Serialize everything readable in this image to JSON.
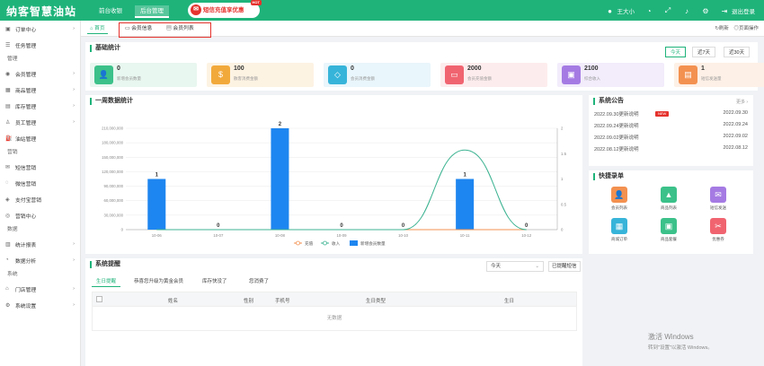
{
  "header": {
    "logo": "纳客智慧油站",
    "tabs": [
      "前台收银",
      "后台管理"
    ],
    "promo": "短信充值享优惠",
    "promo_badge": "HOT",
    "user": "王大小",
    "logout": "退出登录"
  },
  "sidebar": {
    "items": [
      {
        "label": "订单中心",
        "icon": "order-icon",
        "arrow": true
      },
      {
        "label": "任务管理",
        "icon": "task-icon",
        "arrow": false
      },
      {
        "group": "管理"
      },
      {
        "label": "会员管理",
        "icon": "member-icon",
        "arrow": true
      },
      {
        "label": "商品管理",
        "icon": "goods-icon",
        "arrow": true
      },
      {
        "label": "库存管理",
        "icon": "stock-icon",
        "arrow": true
      },
      {
        "label": "员工管理",
        "icon": "staff-icon",
        "arrow": true
      },
      {
        "label": "油站管理",
        "icon": "station-icon",
        "arrow": false
      },
      {
        "group": "营销"
      },
      {
        "label": "短信营销",
        "icon": "sms-icon",
        "arrow": false
      },
      {
        "label": "微信营销",
        "icon": "wechat-icon",
        "arrow": false
      },
      {
        "label": "支付宝营销",
        "icon": "alipay-icon",
        "arrow": false
      },
      {
        "label": "营销中心",
        "icon": "marketing-icon",
        "arrow": false
      },
      {
        "group": "数据"
      },
      {
        "label": "统计报表",
        "icon": "report-icon",
        "arrow": true
      },
      {
        "label": "数据分析",
        "icon": "analysis-icon",
        "arrow": true
      },
      {
        "group": "系统"
      },
      {
        "label": "门店管理",
        "icon": "store-icon",
        "arrow": true
      },
      {
        "label": "系统设置",
        "icon": "settings-icon",
        "arrow": true
      }
    ]
  },
  "tabbar": {
    "home": "首页",
    "member_info": "会员信息",
    "member_list": "会员列表",
    "refresh": "刷新",
    "page_ops": "页面操作"
  },
  "basic": {
    "title": "基础统计",
    "ranges": [
      "今天",
      "近7天",
      "近30天"
    ],
    "cards": [
      {
        "value": "0",
        "label": "新增会员数量",
        "bg": "#e8f7f0",
        "color": "#3cc18a",
        "icon": "person-icon",
        "glyph": "👤"
      },
      {
        "value": "100",
        "label": "散客消费金额",
        "bg": "#fdf3e3",
        "color": "#f2a93b",
        "icon": "coin-icon",
        "glyph": "$"
      },
      {
        "value": "0",
        "label": "会员消费金额",
        "bg": "#e9f6fb",
        "color": "#37b4d9",
        "icon": "diamond-icon",
        "glyph": "◇"
      },
      {
        "value": "2000",
        "label": "会员充值金额",
        "bg": "#fdeced",
        "color": "#f06470",
        "icon": "card-icon",
        "glyph": "▭"
      },
      {
        "value": "2100",
        "label": "综合收入",
        "bg": "#f2ecfb",
        "color": "#a57be3",
        "icon": "wallet-icon",
        "glyph": "▣"
      },
      {
        "value": "1",
        "label": "短信发送量",
        "bg": "#fdf0e6",
        "color": "#f39150",
        "icon": "document-icon",
        "glyph": "▤"
      }
    ]
  },
  "week": {
    "title": "一周数据统计"
  },
  "chart_data": {
    "type": "bar",
    "categories": [
      "10-06",
      "10-07",
      "10-08",
      "10-09",
      "10-10",
      "10-11",
      "10-12"
    ],
    "series": [
      {
        "name": "充值",
        "type": "line",
        "axis": "left",
        "values": [
          0,
          0,
          0,
          0,
          0,
          0,
          0
        ],
        "color": "#f39150"
      },
      {
        "name": "收入",
        "type": "line",
        "axis": "left",
        "values": [
          0,
          0,
          0,
          0,
          0,
          165000000,
          0
        ],
        "color": "#3cb391"
      },
      {
        "name": "新增会员数量",
        "type": "bar",
        "axis": "right",
        "values": [
          1,
          0,
          2,
          0,
          0,
          1,
          0
        ],
        "color": "#1e86f0"
      }
    ],
    "left_ticks": [
      "0",
      "30,000,000",
      "60,000,000",
      "90,000,000",
      "120,000,000",
      "150,000,000",
      "180,000,000",
      "210,000,000"
    ],
    "right_ticks": [
      "0",
      "0.5",
      "1",
      "1.5",
      "2"
    ],
    "ylim_left": [
      0,
      210000000
    ],
    "ylim_right": [
      0,
      2
    ],
    "legend_position": "bottom"
  },
  "notice": {
    "title": "系统公告",
    "more": "更多 ›",
    "badge": "NEW",
    "items": [
      {
        "text": "2022.09.30更新说明",
        "date": "2022.09.30"
      },
      {
        "text": "2022.09.24更新说明",
        "date": "2022.09.24"
      },
      {
        "text": "2022.09.02更新说明",
        "date": "2022.09.02"
      },
      {
        "text": "2022.08.12更新说明",
        "date": "2022.08.12"
      }
    ]
  },
  "quick": {
    "title": "快捷录单",
    "items": [
      {
        "label": "会员列表",
        "color": "#f39150",
        "icon": "member-list-icon",
        "glyph": "👤"
      },
      {
        "label": "商品列表",
        "color": "#3cc18a",
        "icon": "shopping-bag-icon",
        "glyph": "▲"
      },
      {
        "label": "短信发送",
        "color": "#a57be3",
        "icon": "mail-icon",
        "glyph": "✉"
      },
      {
        "label": "商城订单",
        "color": "#37b4d9",
        "icon": "mall-order-icon",
        "glyph": "▦"
      },
      {
        "label": "商品套餐",
        "color": "#3cc18a",
        "icon": "package-icon",
        "glyph": "▣"
      },
      {
        "label": "优惠券",
        "color": "#f06470",
        "icon": "coupon-icon",
        "glyph": "✂"
      }
    ]
  },
  "remind": {
    "title": "系统提醒",
    "select_value": "今天",
    "action": "已提醒短信",
    "tabs": [
      "生日提醒",
      "恭喜您升级为黄金会员",
      "库存快没了",
      "您消费了"
    ],
    "columns": [
      "姓名",
      "性别",
      "手机号",
      "生日类型",
      "生日"
    ],
    "empty": "无数据"
  },
  "watermark": {
    "line1": "激活 Windows",
    "line2": "转到\"设置\"以激活 Windows。"
  }
}
